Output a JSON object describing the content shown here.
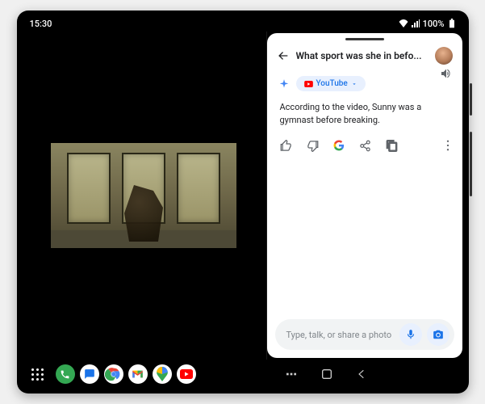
{
  "status": {
    "time": "15:30",
    "battery": "100%"
  },
  "assistant": {
    "header_title": "What sport was she in befo...",
    "source_chip": "YouTube",
    "response": "According to the video, Sunny was a gymnast before breaking.",
    "input_placeholder": "Type, talk, or share a photo"
  }
}
